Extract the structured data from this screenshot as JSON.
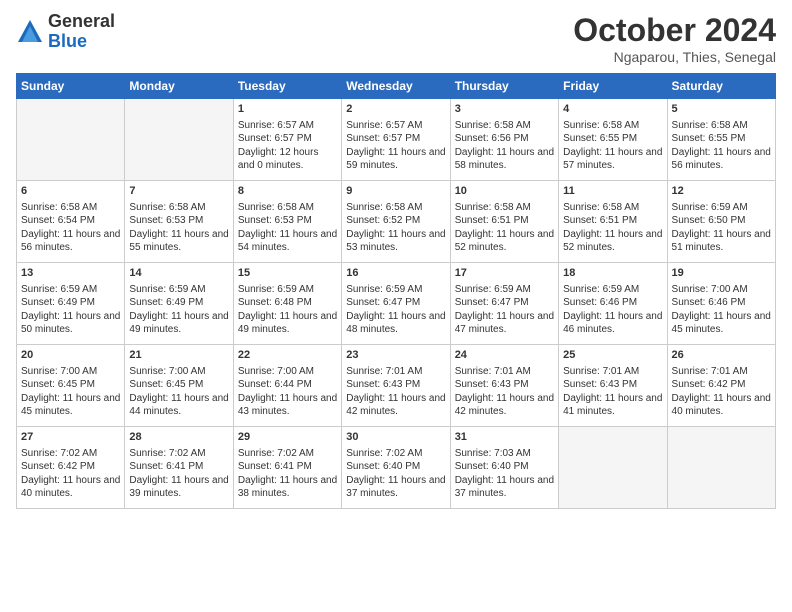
{
  "logo": {
    "general": "General",
    "blue": "Blue"
  },
  "title": "October 2024",
  "location": "Ngaparou, Thies, Senegal",
  "days": [
    "Sunday",
    "Monday",
    "Tuesday",
    "Wednesday",
    "Thursday",
    "Friday",
    "Saturday"
  ],
  "weeks": [
    [
      {
        "num": "",
        "empty": true
      },
      {
        "num": "",
        "empty": true
      },
      {
        "num": "1",
        "sunrise": "Sunrise: 6:57 AM",
        "sunset": "Sunset: 6:57 PM",
        "daylight": "Daylight: 12 hours and 0 minutes."
      },
      {
        "num": "2",
        "sunrise": "Sunrise: 6:57 AM",
        "sunset": "Sunset: 6:57 PM",
        "daylight": "Daylight: 11 hours and 59 minutes."
      },
      {
        "num": "3",
        "sunrise": "Sunrise: 6:58 AM",
        "sunset": "Sunset: 6:56 PM",
        "daylight": "Daylight: 11 hours and 58 minutes."
      },
      {
        "num": "4",
        "sunrise": "Sunrise: 6:58 AM",
        "sunset": "Sunset: 6:55 PM",
        "daylight": "Daylight: 11 hours and 57 minutes."
      },
      {
        "num": "5",
        "sunrise": "Sunrise: 6:58 AM",
        "sunset": "Sunset: 6:55 PM",
        "daylight": "Daylight: 11 hours and 56 minutes."
      }
    ],
    [
      {
        "num": "6",
        "sunrise": "Sunrise: 6:58 AM",
        "sunset": "Sunset: 6:54 PM",
        "daylight": "Daylight: 11 hours and 56 minutes."
      },
      {
        "num": "7",
        "sunrise": "Sunrise: 6:58 AM",
        "sunset": "Sunset: 6:53 PM",
        "daylight": "Daylight: 11 hours and 55 minutes."
      },
      {
        "num": "8",
        "sunrise": "Sunrise: 6:58 AM",
        "sunset": "Sunset: 6:53 PM",
        "daylight": "Daylight: 11 hours and 54 minutes."
      },
      {
        "num": "9",
        "sunrise": "Sunrise: 6:58 AM",
        "sunset": "Sunset: 6:52 PM",
        "daylight": "Daylight: 11 hours and 53 minutes."
      },
      {
        "num": "10",
        "sunrise": "Sunrise: 6:58 AM",
        "sunset": "Sunset: 6:51 PM",
        "daylight": "Daylight: 11 hours and 52 minutes."
      },
      {
        "num": "11",
        "sunrise": "Sunrise: 6:58 AM",
        "sunset": "Sunset: 6:51 PM",
        "daylight": "Daylight: 11 hours and 52 minutes."
      },
      {
        "num": "12",
        "sunrise": "Sunrise: 6:59 AM",
        "sunset": "Sunset: 6:50 PM",
        "daylight": "Daylight: 11 hours and 51 minutes."
      }
    ],
    [
      {
        "num": "13",
        "sunrise": "Sunrise: 6:59 AM",
        "sunset": "Sunset: 6:49 PM",
        "daylight": "Daylight: 11 hours and 50 minutes."
      },
      {
        "num": "14",
        "sunrise": "Sunrise: 6:59 AM",
        "sunset": "Sunset: 6:49 PM",
        "daylight": "Daylight: 11 hours and 49 minutes."
      },
      {
        "num": "15",
        "sunrise": "Sunrise: 6:59 AM",
        "sunset": "Sunset: 6:48 PM",
        "daylight": "Daylight: 11 hours and 49 minutes."
      },
      {
        "num": "16",
        "sunrise": "Sunrise: 6:59 AM",
        "sunset": "Sunset: 6:47 PM",
        "daylight": "Daylight: 11 hours and 48 minutes."
      },
      {
        "num": "17",
        "sunrise": "Sunrise: 6:59 AM",
        "sunset": "Sunset: 6:47 PM",
        "daylight": "Daylight: 11 hours and 47 minutes."
      },
      {
        "num": "18",
        "sunrise": "Sunrise: 6:59 AM",
        "sunset": "Sunset: 6:46 PM",
        "daylight": "Daylight: 11 hours and 46 minutes."
      },
      {
        "num": "19",
        "sunrise": "Sunrise: 7:00 AM",
        "sunset": "Sunset: 6:46 PM",
        "daylight": "Daylight: 11 hours and 45 minutes."
      }
    ],
    [
      {
        "num": "20",
        "sunrise": "Sunrise: 7:00 AM",
        "sunset": "Sunset: 6:45 PM",
        "daylight": "Daylight: 11 hours and 45 minutes."
      },
      {
        "num": "21",
        "sunrise": "Sunrise: 7:00 AM",
        "sunset": "Sunset: 6:45 PM",
        "daylight": "Daylight: 11 hours and 44 minutes."
      },
      {
        "num": "22",
        "sunrise": "Sunrise: 7:00 AM",
        "sunset": "Sunset: 6:44 PM",
        "daylight": "Daylight: 11 hours and 43 minutes."
      },
      {
        "num": "23",
        "sunrise": "Sunrise: 7:01 AM",
        "sunset": "Sunset: 6:43 PM",
        "daylight": "Daylight: 11 hours and 42 minutes."
      },
      {
        "num": "24",
        "sunrise": "Sunrise: 7:01 AM",
        "sunset": "Sunset: 6:43 PM",
        "daylight": "Daylight: 11 hours and 42 minutes."
      },
      {
        "num": "25",
        "sunrise": "Sunrise: 7:01 AM",
        "sunset": "Sunset: 6:43 PM",
        "daylight": "Daylight: 11 hours and 41 minutes."
      },
      {
        "num": "26",
        "sunrise": "Sunrise: 7:01 AM",
        "sunset": "Sunset: 6:42 PM",
        "daylight": "Daylight: 11 hours and 40 minutes."
      }
    ],
    [
      {
        "num": "27",
        "sunrise": "Sunrise: 7:02 AM",
        "sunset": "Sunset: 6:42 PM",
        "daylight": "Daylight: 11 hours and 40 minutes."
      },
      {
        "num": "28",
        "sunrise": "Sunrise: 7:02 AM",
        "sunset": "Sunset: 6:41 PM",
        "daylight": "Daylight: 11 hours and 39 minutes."
      },
      {
        "num": "29",
        "sunrise": "Sunrise: 7:02 AM",
        "sunset": "Sunset: 6:41 PM",
        "daylight": "Daylight: 11 hours and 38 minutes."
      },
      {
        "num": "30",
        "sunrise": "Sunrise: 7:02 AM",
        "sunset": "Sunset: 6:40 PM",
        "daylight": "Daylight: 11 hours and 37 minutes."
      },
      {
        "num": "31",
        "sunrise": "Sunrise: 7:03 AM",
        "sunset": "Sunset: 6:40 PM",
        "daylight": "Daylight: 11 hours and 37 minutes."
      },
      {
        "num": "",
        "empty": true
      },
      {
        "num": "",
        "empty": true
      }
    ]
  ]
}
